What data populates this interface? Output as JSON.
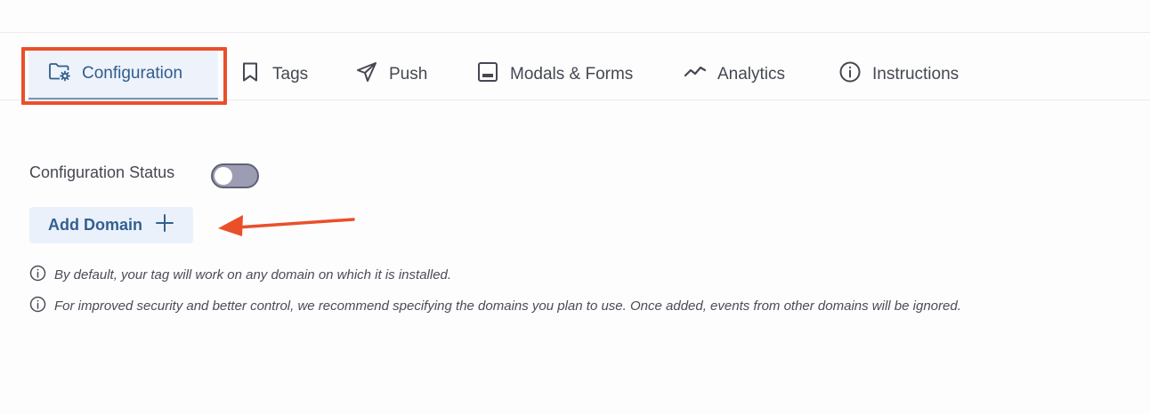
{
  "tabs": [
    {
      "label": "Configuration",
      "icon": "folder-gear-icon",
      "active": true
    },
    {
      "label": "Tags",
      "icon": "bookmark-icon",
      "active": false
    },
    {
      "label": "Push",
      "icon": "send-icon",
      "active": false
    },
    {
      "label": "Modals & Forms",
      "icon": "modal-window-icon",
      "active": false
    },
    {
      "label": "Analytics",
      "icon": "trend-line-icon",
      "active": false
    },
    {
      "label": "Instructions",
      "icon": "info-circle-icon",
      "active": false
    }
  ],
  "config": {
    "status_label": "Configuration Status",
    "status_enabled": false,
    "add_domain_label": "Add Domain"
  },
  "notes": [
    "By default, your tag will work on any domain on which it is installed.",
    "For improved security and better control, we recommend specifying the domains you plan to use. Once added, events from other domains will be ignored."
  ],
  "colors": {
    "accent": "#2f5d8c",
    "highlight": "#ea4f2a",
    "toggle_off": "#9c9db2"
  }
}
